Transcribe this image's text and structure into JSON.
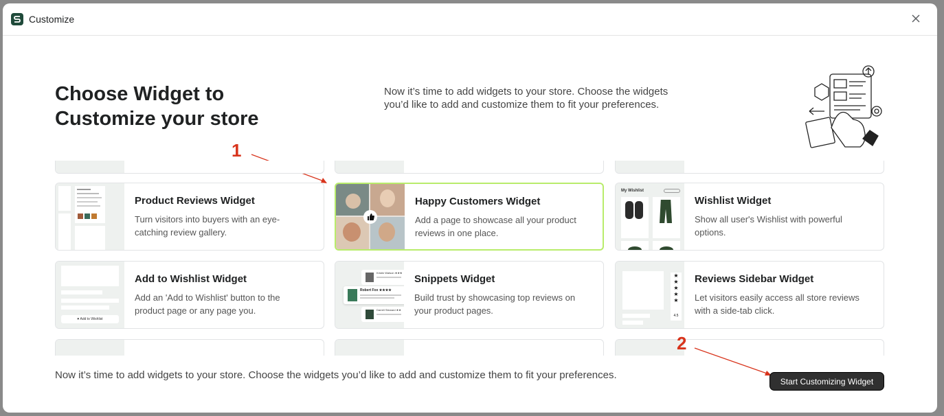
{
  "window": {
    "title": "Customize"
  },
  "header": {
    "heading_line1": "Choose Widget to",
    "heading_line2": "Customize your store",
    "intro": "Now it’s time to add widgets to your store. Choose the widgets you’d like to add and customize them to fit your preferences."
  },
  "widgets": [
    {
      "title": "Product Reviews Widget",
      "desc": "Turn visitors into buyers with an eye-catching review gallery.",
      "selected": false
    },
    {
      "title": "Happy Customers Widget",
      "desc": "Add a page to showcase all your product reviews in one place.",
      "selected": true
    },
    {
      "title": "Wishlist Widget",
      "desc": "Show all user's Wishlist with powerful options.",
      "selected": false
    },
    {
      "title": "Add to Wishlist Widget",
      "desc": "Add an 'Add to Wishlist' button to the product page or any page you.",
      "selected": false
    },
    {
      "title": "Snippets Widget",
      "desc": "Build trust by showcasing top reviews on your product pages.",
      "selected": false
    },
    {
      "title": "Reviews Sidebar Widget",
      "desc": "Let visitors easily access all store reviews with a side-tab click.",
      "selected": false
    }
  ],
  "thumb_text": {
    "wishlist_label": "My Wishlist",
    "add_to_wishlist_label": "♥ Add to Wishlist",
    "snippet_names": [
      "Kristin Watson ★★★",
      "Robert Fox ★★★★",
      "Darrell Steward ★★"
    ],
    "sidebar_score": "4.5"
  },
  "footer": {
    "text": "Now it’s time to add widgets to your store. Choose the widgets you’d like to add and customize them to fit your preferences.",
    "cta_label": "Start Customizing Widget"
  },
  "annotations": {
    "marker1": "1",
    "marker2": "2"
  },
  "colors": {
    "accent": "#b8ec6a",
    "cta_bg": "#303030",
    "annotation": "#d8341c",
    "brand": "#1f4a3a"
  }
}
